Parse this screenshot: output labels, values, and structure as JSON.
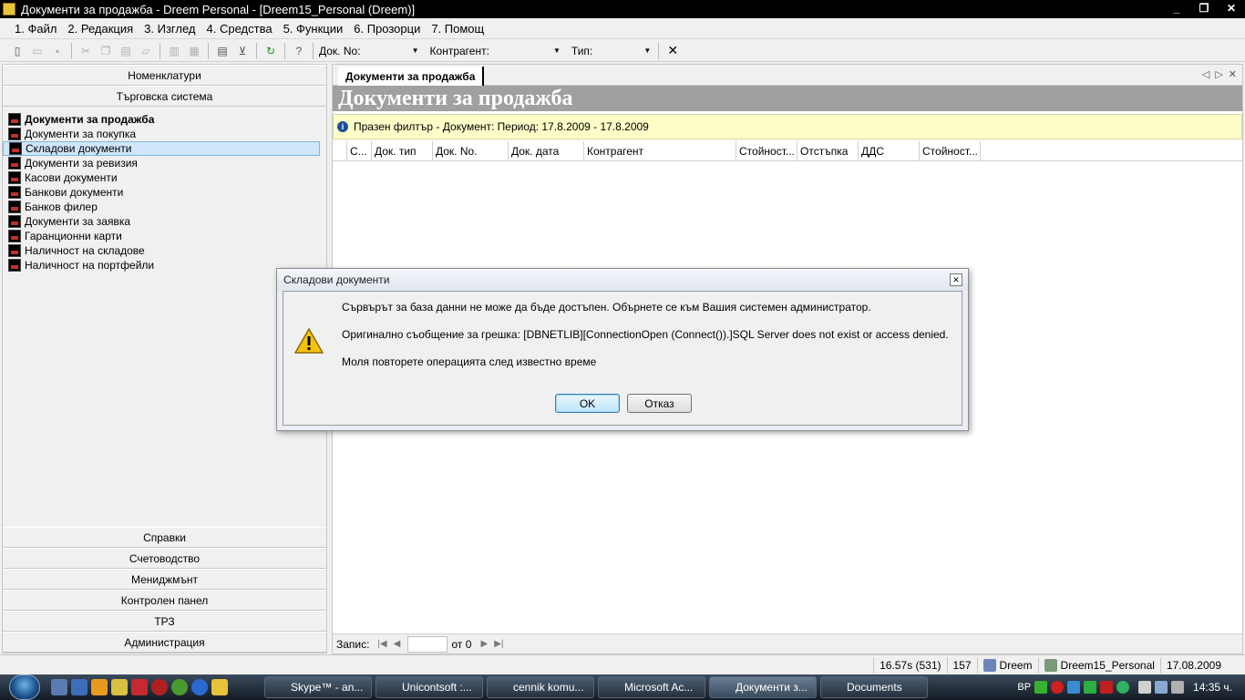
{
  "window": {
    "title": "Документи за продажба - Dreem Personal - [Dreem15_Personal (Dreem)]",
    "controls": {
      "minimize": "_",
      "restore": "❐",
      "close": "✕"
    }
  },
  "menu": [
    "1. Файл",
    "2. Редакция",
    "3. Изглед",
    "4. Средства",
    "5. Функции",
    "6. Прозорци",
    "7. Помощ"
  ],
  "toolbar": {
    "doc_no_label": "Док. No:",
    "doc_no_value": "",
    "contragent_label": "Контрагент:",
    "contragent_value": "",
    "type_label": "Тип:",
    "type_value": "",
    "clear_icon": "✕"
  },
  "left_panel": {
    "top_groups": [
      "Номенклатури",
      "Търговска система"
    ],
    "items": [
      "Документи за продажба",
      "Документи за покупка",
      "Складови документи",
      "Документи за ревизия",
      "Касови документи",
      "Банкови документи",
      "Банков филер",
      "Документи за заявка",
      "Гаранционни карти",
      "Наличност на складове",
      "Наличност на портфейли"
    ],
    "bottom_groups": [
      "Справки",
      "Счетоводство",
      "Мениджмънт",
      "Контролен панел",
      "ТРЗ",
      "Администрация"
    ]
  },
  "main": {
    "tab_label": "Документи за продажба",
    "heading": "Документи за продажба",
    "filter_text": "Празен филтър - Документ: Период: 17.8.2009 - 17.8.2009",
    "columns": [
      "С...",
      "Док. тип",
      "Док. No.",
      "Док. дата",
      "Контрагент",
      "Стойност...",
      "Отстъпка",
      "ДДС",
      "Стойност..."
    ],
    "pager": {
      "label": "Запис:",
      "value": "",
      "of_text": "от 0"
    }
  },
  "status_bar": {
    "timing": "16.57s (531)",
    "count": "157",
    "user": "Dreem",
    "database": "Dreem15_Personal",
    "date": "17.08.2009"
  },
  "dialog": {
    "title": "Складови документи",
    "line1": "Сървърът за база данни не може да бъде достъпен. Обърнете се към Вашия системен администратор.",
    "line2": "Оригинално съобщение за грешка: [DBNETLIB][ConnectionOpen (Connect()).]SQL Server does not exist or access denied.",
    "line3": "Моля повторете операцията след известно време",
    "ok_label": "OK",
    "cancel_label": "Отказ"
  },
  "taskbar": {
    "buttons": [
      {
        "label": "Skype™ - an...",
        "color": "#1fa0e0"
      },
      {
        "label": "Unicontsoft :...",
        "color": "#e04030"
      },
      {
        "label": "cennik komu...",
        "color": "#2a5caa"
      },
      {
        "label": "Microsoft Ac...",
        "color": "#b03030"
      },
      {
        "label": "Документи з...",
        "color": "#e8c23a"
      },
      {
        "label": "Documents",
        "color": "#d8b050"
      }
    ],
    "lang": "BP",
    "clock": "14:35 ч."
  }
}
